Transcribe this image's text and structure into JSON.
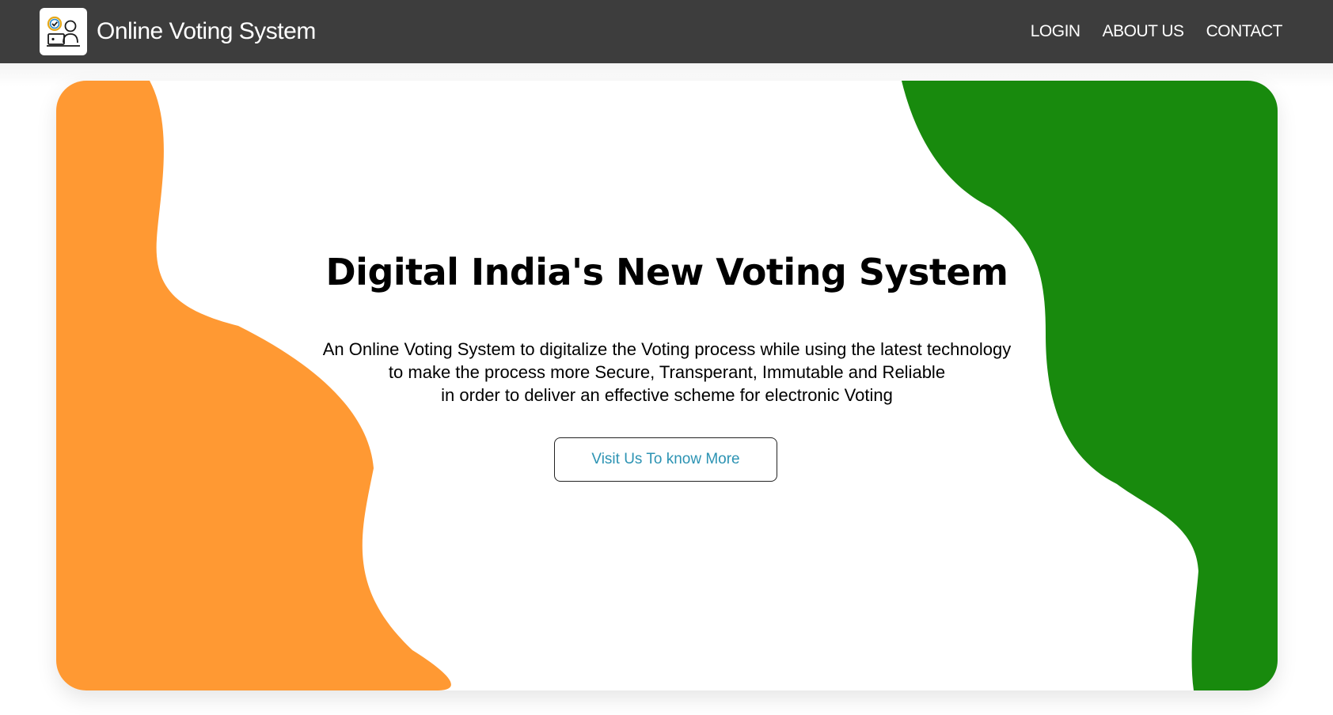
{
  "brand": {
    "title": "Online Voting System",
    "logo_icon": "voter-laptop-icon"
  },
  "nav": {
    "items": [
      {
        "label": "LOGIN"
      },
      {
        "label": "ABOUT US"
      },
      {
        "label": "CONTACT"
      }
    ]
  },
  "hero": {
    "title": "Digital India's New Voting System",
    "description": [
      "An Online Voting System to digitalize the Voting process while using the latest technology",
      "to make the process more Secure, Transperant, Immutable and Reliable",
      "in order to deliver an effective scheme for electronic Voting"
    ],
    "cta_label": "Visit Us To know More"
  },
  "colors": {
    "navbar": "#3d3d3d",
    "saffron": "#ff9933",
    "green": "#188a0d",
    "cta_text": "#2c93b3"
  }
}
